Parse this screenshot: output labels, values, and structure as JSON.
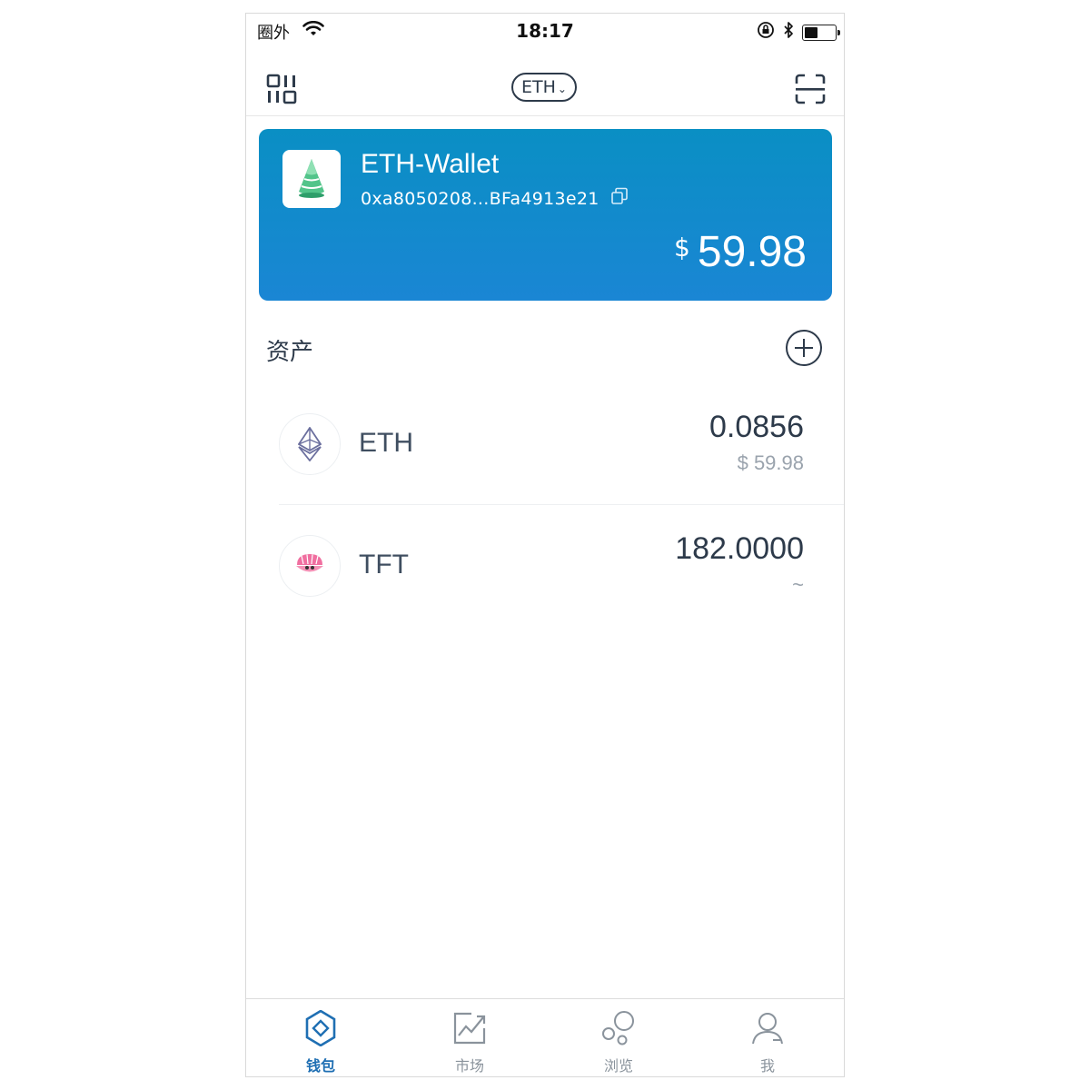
{
  "status_bar": {
    "carrier": "圈外",
    "time": "18:17"
  },
  "nav": {
    "chain_selector": "ETH"
  },
  "wallet": {
    "name": "ETH-Wallet",
    "address": "0xa8050208...BFa4913e21",
    "currency_symbol": "$",
    "balance": "59.98"
  },
  "assets": {
    "title": "资产",
    "items": [
      {
        "symbol": "ETH",
        "quantity": "0.0856",
        "value": "$ 59.98"
      },
      {
        "symbol": "TFT",
        "quantity": "182.0000",
        "value": "~"
      }
    ]
  },
  "tabs": [
    {
      "label": "钱包",
      "icon": "wallet-icon",
      "active": true
    },
    {
      "label": "市场",
      "icon": "market-chart-icon",
      "active": false
    },
    {
      "label": "浏览",
      "icon": "browse-bubbles-icon",
      "active": false
    },
    {
      "label": "我",
      "icon": "profile-icon",
      "active": false
    }
  ],
  "colors": {
    "card_gradient_top": "#0a8fc4",
    "card_gradient_bottom": "#1a86d4",
    "active_tab": "#1f6fb3",
    "text_dark": "#2d3a4a",
    "text_muted": "#9aa3ad"
  }
}
